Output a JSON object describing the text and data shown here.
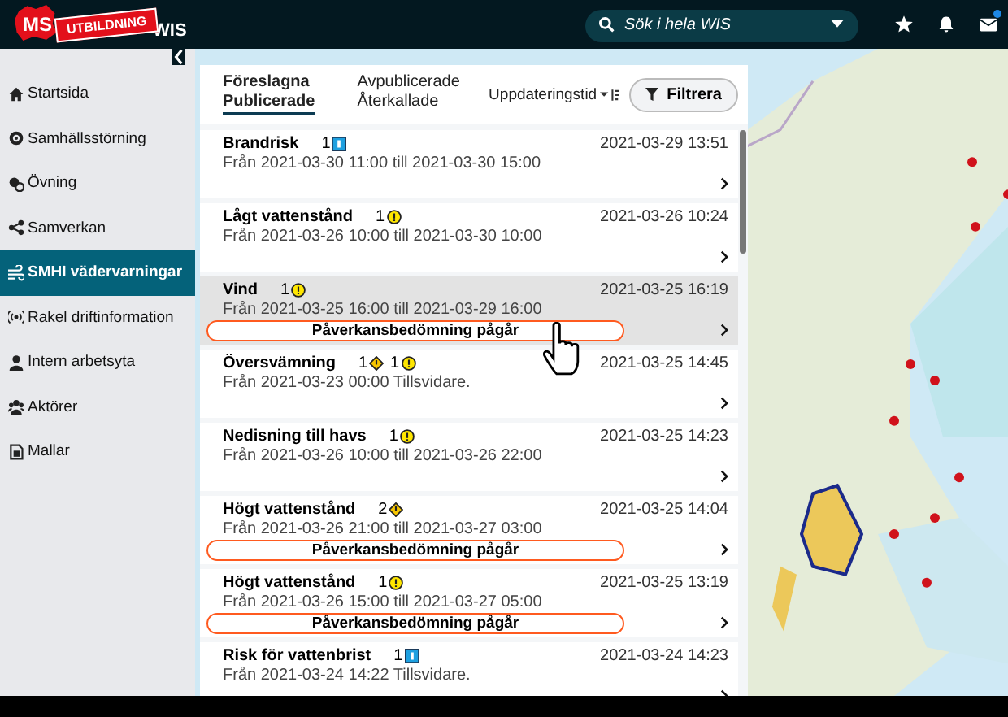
{
  "header": {
    "logo_text": "MS",
    "stamp": "UTBILDNING",
    "app_name": "WIS",
    "search": {
      "placeholder": "Sök i hela WIS"
    },
    "mail_unread": true
  },
  "sidebar": {
    "items": [
      {
        "label": "Startsida",
        "selected": false
      },
      {
        "label": "Samhällsstörning",
        "selected": false
      },
      {
        "label": "Övning",
        "selected": false
      },
      {
        "label": "Samverkan",
        "selected": false
      },
      {
        "label": "SMHI vädervarningar",
        "selected": true
      },
      {
        "label": "Rakel driftinformation",
        "selected": false
      },
      {
        "label": "Intern arbetsyta",
        "selected": false
      },
      {
        "label": "Aktörer",
        "selected": false
      },
      {
        "label": "Mallar",
        "selected": false
      }
    ]
  },
  "tabs": [
    {
      "label": "Föreslagna",
      "selected": false
    },
    {
      "label": "Publicerade",
      "selected": true
    },
    {
      "label": "Avpublicerade",
      "selected": false
    },
    {
      "label": "Återkallade",
      "selected": false
    }
  ],
  "sort": {
    "label": "Uppdateringstid"
  },
  "filter_button": "Filtrera",
  "warnings": [
    {
      "title": "Brandrisk",
      "levels": [
        {
          "count": "1",
          "kind": "square"
        }
      ],
      "period": "Från 2021-03-30 11:00 till 2021-03-30 15:00",
      "updated": "2021-03-29 13:51",
      "selected": false
    },
    {
      "title": "Lågt vattenstånd",
      "levels": [
        {
          "count": "1",
          "kind": "circle"
        }
      ],
      "period": "Från 2021-03-26 10:00 till 2021-03-30 10:00",
      "updated": "2021-03-26 10:24",
      "selected": false
    },
    {
      "title": "Vind",
      "levels": [
        {
          "count": "1",
          "kind": "circle"
        }
      ],
      "period": "Från 2021-03-25 16:00 till 2021-03-29 16:00",
      "updated": "2021-03-25 16:19",
      "selected": true,
      "badge": "Påverkansbedömning pågår"
    },
    {
      "title": "Översvämning",
      "levels": [
        {
          "count": "1",
          "kind": "diamond"
        },
        {
          "count": "1",
          "kind": "circle"
        }
      ],
      "period": "Från 2021-03-23 00:00 Tillsvidare.",
      "updated": "2021-03-25 14:45",
      "selected": false
    },
    {
      "title": "Nedisning till havs",
      "levels": [
        {
          "count": "1",
          "kind": "circle"
        }
      ],
      "period": "Från 2021-03-26 10:00 till 2021-03-26 22:00",
      "updated": "2021-03-25 14:23",
      "selected": false
    },
    {
      "title": "Högt vattenstånd",
      "levels": [
        {
          "count": "2",
          "kind": "diamond"
        }
      ],
      "period": "Från 2021-03-26 21:00 till 2021-03-27 03:00",
      "updated": "2021-03-25 14:04",
      "selected": false,
      "badge": "Påverkansbedömning pågår"
    },
    {
      "title": "Högt vattenstånd",
      "levels": [
        {
          "count": "1",
          "kind": "circle"
        }
      ],
      "period": "Från 2021-03-26 15:00 till 2021-03-27 05:00",
      "updated": "2021-03-25 13:19",
      "selected": false,
      "badge": "Påverkansbedömning pågår"
    },
    {
      "title": "Risk för vattenbrist",
      "levels": [
        {
          "count": "1",
          "kind": "square"
        }
      ],
      "period": "Från 2021-03-24 14:22 Tillsvidare.",
      "updated": "2021-03-24 14:23",
      "selected": false
    }
  ]
}
